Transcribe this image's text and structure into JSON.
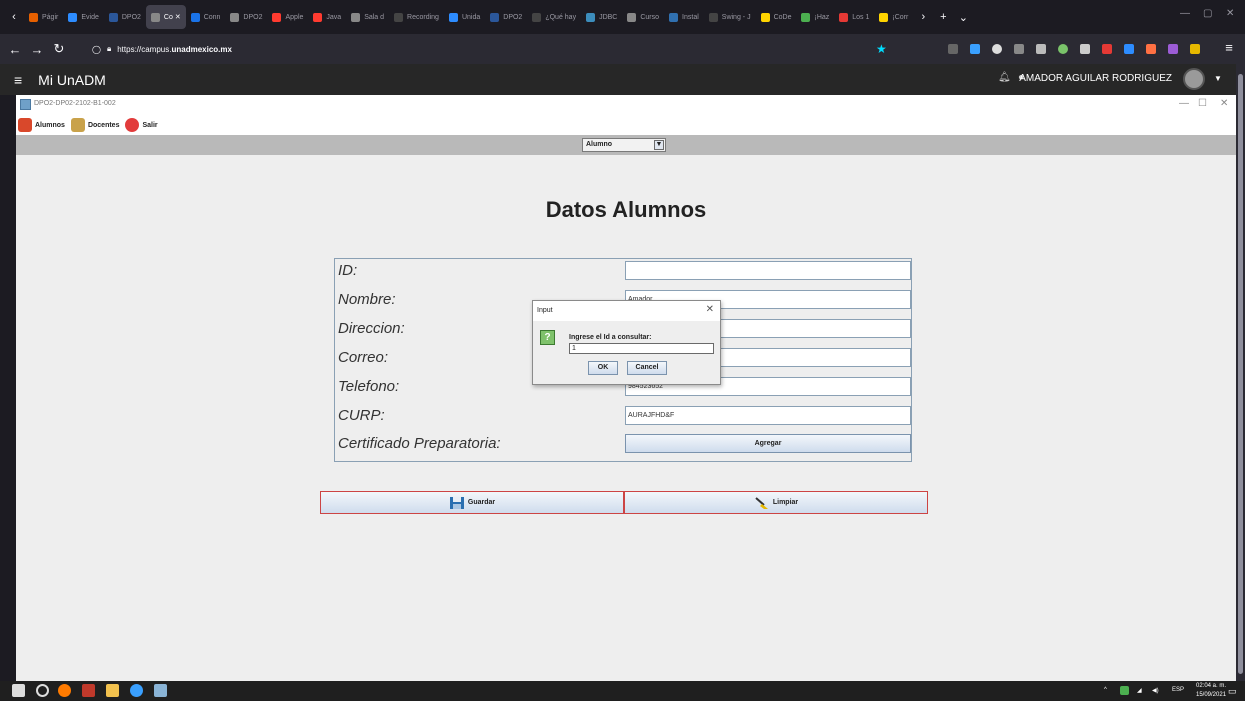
{
  "browser": {
    "tabs": [
      {
        "label": "Págir",
        "color": "#e66000"
      },
      {
        "label": "Evide",
        "color": "#2d8cff"
      },
      {
        "label": "DPO2",
        "color": "#2b579a"
      },
      {
        "label": "Co ✕",
        "color": "#888888",
        "active": true
      },
      {
        "label": "Conn",
        "color": "#1a73e8"
      },
      {
        "label": "DPO2",
        "color": "#888888"
      },
      {
        "label": "Apple",
        "color": "#ff3b30"
      },
      {
        "label": "Java",
        "color": "#ff3b30"
      },
      {
        "label": "Sala d",
        "color": "#888888"
      },
      {
        "label": "Recording",
        "color": "#444444"
      },
      {
        "label": "Unida",
        "color": "#2d8cff"
      },
      {
        "label": "DPO2",
        "color": "#2b579a"
      },
      {
        "label": "¿Qué hay",
        "color": "#444444"
      },
      {
        "label": "JDBC",
        "color": "#3c8dbc"
      },
      {
        "label": "Curso",
        "color": "#888888"
      },
      {
        "label": "Instal",
        "color": "#3070b0"
      },
      {
        "label": "Swing - J",
        "color": "#444444"
      },
      {
        "label": "CoDe",
        "color": "#ffd400"
      },
      {
        "label": "¡Haz",
        "color": "#4caf50"
      },
      {
        "label": "Los 1",
        "color": "#e53935"
      },
      {
        "label": "¡Corr",
        "color": "#ffd400"
      }
    ],
    "url_scheme": "https://campus.",
    "url_host": "unadmexico.mx"
  },
  "unadm": {
    "brand": "Mi UnADM",
    "user": "AMADOR AGUILAR RODRIGUEZ"
  },
  "app": {
    "window_title": "DPO2-DP02-2102-B1-002",
    "menu": {
      "alumnos": "Alumnos",
      "docentes": "Docentes",
      "salir": "Salir"
    },
    "combo_value": "Alumno",
    "heading": "Datos Alumnos",
    "fields": [
      {
        "label": "ID:",
        "value": ""
      },
      {
        "label": "Nombre:",
        "value": "Amador"
      },
      {
        "label": "Direccion:",
        "value": ""
      },
      {
        "label": "Correo:",
        "value": ""
      },
      {
        "label": "Telefono:",
        "value": "984523652"
      },
      {
        "label": "CURP:",
        "value": "AURAJFHD&F"
      }
    ],
    "certificado_label": "Certificado Preparatoria:",
    "agregar_label": "Agregar",
    "guardar_label": "Guardar",
    "limpiar_label": "Limpiar"
  },
  "dialog": {
    "title": "Input",
    "prompt": "Ingrese el Id a consultar:",
    "value": "1",
    "ok_label": "OK",
    "cancel_label": "Cancel"
  },
  "taskbar": {
    "lang": "ESP",
    "time": "02:04 a. m.",
    "date": "15/09/2021"
  }
}
